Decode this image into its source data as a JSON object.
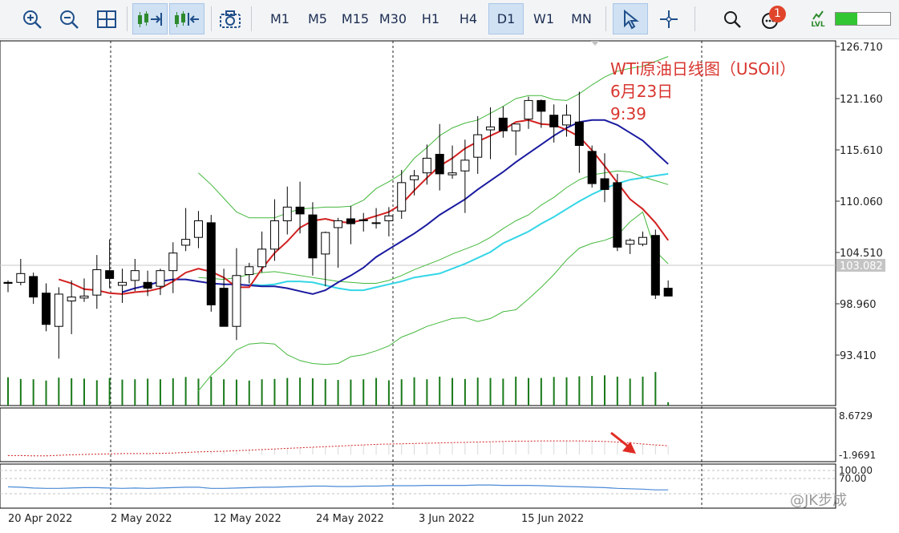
{
  "toolbar": {
    "timeframes": [
      "M1",
      "M5",
      "M15",
      "M30",
      "H1",
      "H4",
      "D1",
      "W1",
      "MN"
    ],
    "active_timeframe": "D1",
    "notification_count": "1",
    "level_label": "LVL"
  },
  "annotation": {
    "line1": "WTi原油日线图（USOil）",
    "line2": "6月23日",
    "line3": "9:39"
  },
  "price_axis": [
    "126.710",
    "121.160",
    "115.610",
    "110.060",
    "104.510",
    "98.960",
    "93.410"
  ],
  "current_price": "103.082",
  "macd_axis": [
    "8.6729",
    "-1.9691"
  ],
  "rsi_axis": [
    "100.00",
    "70.00"
  ],
  "date_labels": [
    "20 Apr 2022",
    "2 May 2022",
    "12 May 2022",
    "24 May 2022",
    "3 Jun 2022",
    "15 Jun 2022"
  ],
  "watermark": "@JK步成",
  "colors": {
    "bull": "#ffffff",
    "bear": "#000000",
    "ma_fast": "#d22020",
    "ma_mid": "#1a1aa0",
    "ma_slow": "#34d6e6",
    "bands": "#44b83c",
    "volume": "#1a7a1a",
    "macd": "#d22020",
    "rsi": "#4a8ad6",
    "annotation": "#d8362f"
  },
  "chart_data": {
    "type": "candlestick",
    "y_range": [
      90.5,
      127.8
    ],
    "candles": [
      [
        103.1,
        103.3,
        102.1,
        103.0
      ],
      [
        103.1,
        105.5,
        102.8,
        104.0
      ],
      [
        103.7,
        104.1,
        100.9,
        101.6
      ],
      [
        102.0,
        103.0,
        98.1,
        98.8
      ],
      [
        98.6,
        102.6,
        95.3,
        101.9
      ],
      [
        101.2,
        103.3,
        97.8,
        101.6
      ],
      [
        101.5,
        103.5,
        101.1,
        101.7
      ],
      [
        101.8,
        105.9,
        100.4,
        104.4
      ],
      [
        104.3,
        107.5,
        102.5,
        103.5
      ],
      [
        102.8,
        104.5,
        101.0,
        103.1
      ],
      [
        103.3,
        105.5,
        102.2,
        104.3
      ],
      [
        103.1,
        104.3,
        101.7,
        102.5
      ],
      [
        102.7,
        104.5,
        101.8,
        104.3
      ],
      [
        104.3,
        107.2,
        102.0,
        106.1
      ],
      [
        106.9,
        110.7,
        106.3,
        107.5
      ],
      [
        107.7,
        110.4,
        106.6,
        109.4
      ],
      [
        109.2,
        110.0,
        100.1,
        100.8
      ],
      [
        102.5,
        104.5,
        100.2,
        98.6
      ],
      [
        98.6,
        106.6,
        97.2,
        103.8
      ],
      [
        103.9,
        105.1,
        103.0,
        104.7
      ],
      [
        104.7,
        108.3,
        104.1,
        106.5
      ],
      [
        106.5,
        111.6,
        105.3,
        109.4
      ],
      [
        109.4,
        112.9,
        108.0,
        110.8
      ],
      [
        110.8,
        113.4,
        108.1,
        110.1
      ],
      [
        110.0,
        111.3,
        103.8,
        105.6
      ],
      [
        106.0,
        108.3,
        102.7,
        108.2
      ],
      [
        108.7,
        109.7,
        104.6,
        109.4
      ],
      [
        109.6,
        110.9,
        107.0,
        109.1
      ],
      [
        109.5,
        110.2,
        108.3,
        109.4
      ],
      [
        109.2,
        110.7,
        108.6,
        109.2
      ],
      [
        109.4,
        110.8,
        107.8,
        109.9
      ],
      [
        110.4,
        114.6,
        109.6,
        113.3
      ],
      [
        113.6,
        114.6,
        112.0,
        114.0
      ],
      [
        114.3,
        117.2,
        113.1,
        115.8
      ],
      [
        116.2,
        119.3,
        112.5,
        114.2
      ],
      [
        114.1,
        117.1,
        113.7,
        114.3
      ],
      [
        114.5,
        117.7,
        110.2,
        115.6
      ],
      [
        115.9,
        120.1,
        114.2,
        118.2
      ],
      [
        118.7,
        121.0,
        115.7,
        119.0
      ],
      [
        119.9,
        121.1,
        117.9,
        118.6
      ],
      [
        118.6,
        119.3,
        116.1,
        119.3
      ],
      [
        119.8,
        122.1,
        118.8,
        121.7
      ],
      [
        121.7,
        121.8,
        118.9,
        120.6
      ],
      [
        120.2,
        121.3,
        117.4,
        119.0
      ],
      [
        119.2,
        121.3,
        118.0,
        120.2
      ],
      [
        119.5,
        122.6,
        114.3,
        117.1
      ],
      [
        116.5,
        117.1,
        112.8,
        113.2
      ],
      [
        113.7,
        116.3,
        111.3,
        112.6
      ],
      [
        113.3,
        114.2,
        106.3,
        106.7
      ],
      [
        107.0,
        107.6,
        106.0,
        107.4
      ],
      [
        107.0,
        108.3,
        106.8,
        107.7
      ],
      [
        107.9,
        108.5,
        101.4,
        101.8
      ],
      [
        102.5,
        103.3,
        102.0,
        101.7
      ]
    ],
    "volume": [
      86,
      81,
      80,
      76,
      85,
      83,
      82,
      77,
      84,
      79,
      80,
      82,
      80,
      83,
      87,
      82,
      88,
      80,
      79,
      76,
      80,
      81,
      84,
      85,
      83,
      81,
      78,
      79,
      80,
      84,
      77,
      80,
      86,
      80,
      88,
      84,
      81,
      85,
      84,
      82,
      88,
      84,
      84,
      87,
      86,
      89,
      90,
      92,
      88,
      82,
      88,
      102,
      10
    ],
    "series": [
      {
        "name": "MA8",
        "color": "#d22020",
        "values": [
          103.4,
          103.0,
          102.4,
          102.3,
          102.0,
          101.9,
          102.1,
          102.2,
          102.5,
          103.2,
          104.1,
          104.5,
          104.2,
          103.6,
          102.6,
          102.6,
          104.5,
          106.1,
          107.3,
          108.7,
          109.4,
          109.6,
          109.3,
          109.2,
          109.5,
          109.9,
          110.3,
          111.1,
          112.5,
          113.8,
          115.0,
          115.8,
          116.8,
          117.5,
          118.1,
          118.7,
          119.5,
          119.7,
          119.3,
          119.2,
          118.7,
          118.0,
          116.6,
          115.0,
          113.3,
          111.6,
          110.6,
          109.2,
          107.4
        ]
      },
      {
        "name": "MA21",
        "color": "#1a1aa0",
        "values": [
          102.1,
          102.5,
          102.8,
          103.2,
          103.4,
          103.4,
          103.2,
          103.0,
          102.9,
          102.9,
          102.8,
          102.7,
          102.7,
          102.5,
          102.2,
          101.9,
          102.3,
          103.1,
          103.8,
          104.6,
          105.7,
          106.5,
          107.3,
          108.1,
          109.0,
          110.0,
          110.8,
          111.6,
          112.6,
          113.5,
          114.4,
          115.4,
          116.3,
          117.2,
          118.1,
          118.9,
          119.5,
          119.7,
          119.7,
          119.2,
          118.4,
          117.6,
          116.4,
          115.2
        ]
      },
      {
        "name": "MA50",
        "color": "#34d6e6",
        "values": [
          102.9,
          102.8,
          102.9,
          103.2,
          103.2,
          103.1,
          102.8,
          102.5,
          102.3,
          102.3,
          102.6,
          102.9,
          103.2,
          103.6,
          103.8,
          104.0,
          104.5,
          105.0,
          105.6,
          106.2,
          107.1,
          107.7,
          108.3,
          109.1,
          109.8,
          110.6,
          111.4,
          112.1,
          112.7,
          113.2,
          113.6,
          113.8,
          114.0,
          114.2
        ]
      },
      {
        "name": "BB upper",
        "color": "#44b83c",
        "values": [
          114.3,
          113.1,
          111.7,
          110.3,
          109.7,
          109.7,
          109.7,
          110.2,
          110.6,
          110.7,
          110.8,
          110.8,
          110.9,
          111.5,
          112.7,
          113.4,
          114.2,
          115.8,
          116.9,
          118.1,
          118.9,
          119.4,
          119.7,
          120.4,
          121.1,
          121.9,
          122.2,
          122.2,
          121.8,
          121.7,
          122.4,
          123.3,
          124.1,
          124.7,
          125.0,
          125.2,
          125.7,
          126.2
        ]
      },
      {
        "name": "BB middle",
        "color": "#44b83c",
        "values": [
          103.6,
          103.5,
          103.4,
          103.6,
          103.9,
          104.1,
          104.2,
          104.0,
          103.8,
          103.6,
          103.4,
          103.2,
          103.1,
          103.0,
          103.0,
          103.3,
          103.8,
          104.4,
          104.9,
          105.4,
          106.0,
          106.5,
          107.0,
          107.7,
          108.6,
          109.4,
          110.0,
          111.0,
          111.8,
          112.8,
          113.6,
          114.1,
          114.3,
          114.5,
          114.4,
          113.9,
          113.5,
          113.1
        ]
      },
      {
        "name": "BB lower",
        "color": "#44b83c",
        "values": [
          92.0,
          93.6,
          94.8,
          96.2,
          96.8,
          96.9,
          96.8,
          95.7,
          95.1,
          94.8,
          94.7,
          94.8,
          95.5,
          95.7,
          96.1,
          96.6,
          97.5,
          98.0,
          98.6,
          99.0,
          99.4,
          99.5,
          99.1,
          99.4,
          100.1,
          100.3,
          101.4,
          102.6,
          103.9,
          105.4,
          106.6,
          107.1,
          107.4,
          107.9,
          109.3,
          110.3,
          106.3,
          105.0
        ]
      }
    ],
    "macd": [
      -0.4,
      -0.4,
      -0.5,
      -0.5,
      -0.3,
      -0.1,
      0,
      0.1,
      0.2,
      0.3,
      0.3,
      0.3,
      0.4,
      0.5,
      0.7,
      0.9,
      1.0,
      1.1,
      1.3,
      1.5,
      1.7,
      1.9,
      2.1,
      2.3,
      2.5,
      2.7,
      2.9,
      3.1,
      3.3,
      3.5,
      3.6,
      3.7,
      3.8,
      3.9,
      4.0,
      4.1,
      4.2,
      4.3,
      4.4,
      4.5,
      4.6,
      4.6,
      4.7,
      4.7,
      4.7,
      4.7,
      4.6,
      4.5,
      4.3,
      4.0,
      3.6,
      3.3,
      3.0
    ],
    "rsi": [
      48,
      47,
      45,
      44,
      44,
      45,
      46,
      46,
      45,
      44,
      45,
      44,
      45,
      46,
      47,
      47,
      44,
      44,
      45,
      46,
      47,
      47,
      48,
      49,
      50,
      50,
      49,
      49,
      50,
      50,
      51,
      51,
      51,
      52,
      52,
      52,
      52,
      53,
      53,
      52,
      52,
      52,
      51,
      50,
      49,
      48,
      47,
      46,
      44,
      43,
      42,
      40,
      40
    ]
  }
}
